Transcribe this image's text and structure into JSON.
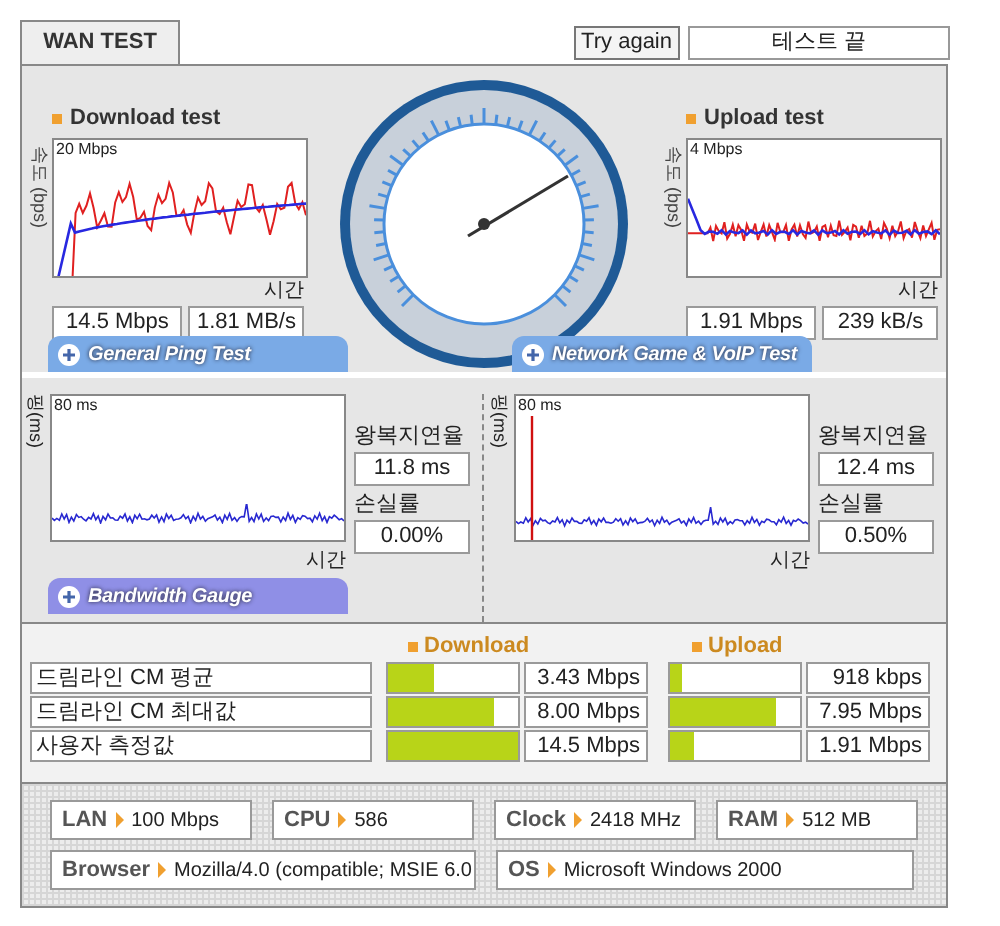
{
  "tab": {
    "label": "WAN TEST",
    "selected": true
  },
  "try_again": "Try again",
  "status": "테스트 끝",
  "speed_tests": [
    {
      "kind": "download",
      "title": "Download test",
      "ylabel": "속도 (bps)",
      "scale": "20 Mbps",
      "xlabel": "시간",
      "rate": "14.5 Mbps",
      "throughput": "1.81 MB/s"
    },
    {
      "kind": "upload",
      "title": "Upload test",
      "ylabel": "속도 (bps)",
      "scale": "4 Mbps",
      "xlabel": "시간",
      "rate": "1.91 Mbps",
      "throughput": "239 kB/s"
    }
  ],
  "ping_tabs": [
    "General Ping Test",
    "Network Game & VoIP Test"
  ],
  "ping_tests": [
    {
      "kind": "general",
      "ylabel": "핑(ms)",
      "scale": "80 ms",
      "xlabel": "시간",
      "latency_label": "왕복지연율",
      "latency": "11.8 ms",
      "loss_label": "손실률",
      "loss": "0.00%"
    },
    {
      "kind": "game",
      "ylabel": "핑(ms)",
      "scale": "80 ms",
      "xlabel": "시간",
      "latency_label": "왕복지연율",
      "latency": "12.4 ms",
      "loss_label": "손실률",
      "loss": "0.50%"
    }
  ],
  "bandwidth_tab": "Bandwidth Gauge",
  "bandwidth": {
    "columns": [
      "Download",
      "Upload"
    ],
    "rows": [
      {
        "label": "드림라인 CM 평균",
        "download": {
          "level": 0.35,
          "reading": "3.43 Mbps"
        },
        "upload": {
          "level": 0.09,
          "reading": "918 kbps"
        }
      },
      {
        "label": "드림라인 CM 최대값",
        "download": {
          "level": 0.82,
          "reading": "8.00 Mbps"
        },
        "upload": {
          "level": 0.81,
          "reading": "7.95 Mbps"
        }
      },
      {
        "label": "사용자 측정값",
        "download": {
          "level": 1.0,
          "reading": "14.5 Mbps"
        },
        "upload": {
          "level": 0.19,
          "reading": "1.91 Mbps"
        }
      }
    ]
  },
  "system_info": [
    {
      "items": [
        {
          "label": "LAN",
          "value": "100 Mbps"
        },
        {
          "label": "CPU",
          "value": "586"
        },
        {
          "label": "Clock",
          "value": "2418 MHz"
        },
        {
          "label": "RAM",
          "value": "512 MB"
        }
      ]
    },
    {
      "items": [
        {
          "label": "Browser",
          "value": "Mozilla/4.0 (compatible; MSIE 6.0"
        },
        {
          "label": "OS",
          "value": "Microsoft Windows 2000"
        }
      ]
    }
  ]
}
